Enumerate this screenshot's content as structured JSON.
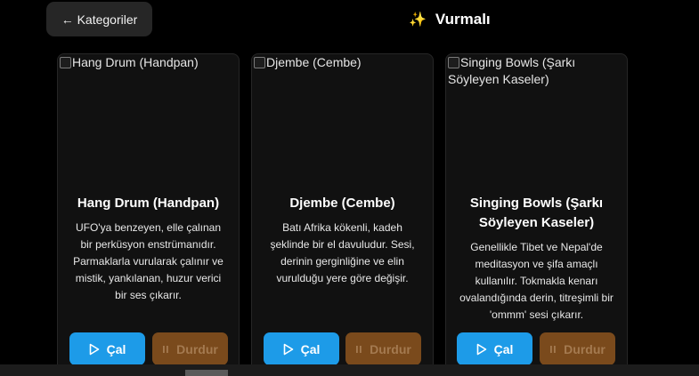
{
  "header": {
    "back_label": "← Kategoriler",
    "title_icon": "sparkles-icon",
    "title": "Vurmalı"
  },
  "cards": [
    {
      "image_alt": "Hang Drum (Handpan)",
      "title": "Hang Drum (Handpan)",
      "description": "UFO'ya benzeyen, elle çalınan bir perküsyon enstrümanıdır. Parmaklarla vurularak çalınır ve mistik, yankılanan, huzur verici bir ses çıkarır.",
      "play_label": "Çal",
      "stop_label": "Durdur"
    },
    {
      "image_alt": "Djembe (Cembe)",
      "title": "Djembe (Cembe)",
      "description": "Batı Afrika kökenli, kadeh şeklinde bir el davuludur. Sesi, derinin gerginliğine ve elin vurulduğu yere göre değişir.",
      "play_label": "Çal",
      "stop_label": "Durdur"
    },
    {
      "image_alt": "Singing Bowls (Şarkı Söyleyen Kaseler)",
      "title": "Singing Bowls (Şarkı Söyleyen Kaseler)",
      "description": "Genellikle Tibet ve Nepal'de meditasyon ve şifa amaçlı kullanılır. Tokmakla kenarı ovalandığında derin, titreşimli bir 'ommm' sesi çıkarır.",
      "play_label": "Çal",
      "stop_label": "Durdur"
    }
  ],
  "colors": {
    "background": "#000000",
    "card": "#111111",
    "play_button": "#1d9be8",
    "stop_button": "#7a4a1c"
  }
}
